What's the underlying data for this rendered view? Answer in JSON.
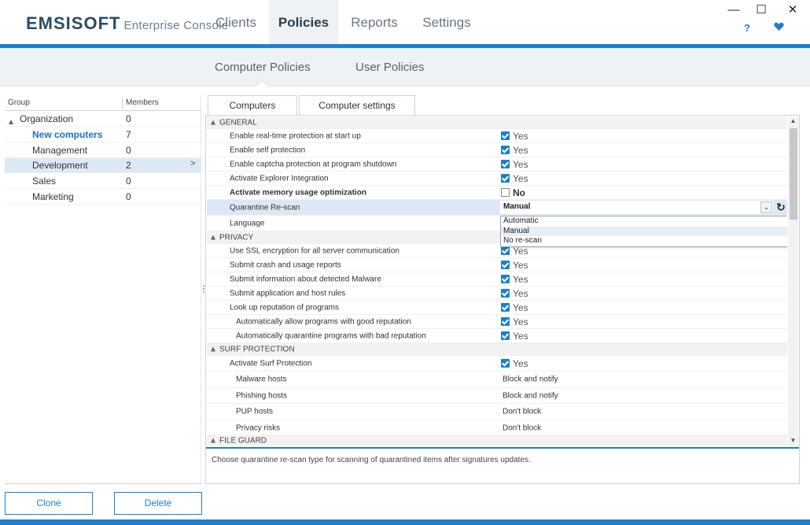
{
  "app": {
    "brand": "EMSISOFT",
    "subtitle": "Enterprise Console",
    "colors": {
      "accent": "#1c7fd0",
      "dark": "#2b4c6a",
      "selection": "#dce9f5"
    }
  },
  "nav": {
    "tabs": [
      {
        "label": "Clients"
      },
      {
        "label": "Policies"
      },
      {
        "label": "Reports"
      },
      {
        "label": "Settings"
      }
    ],
    "active": "Policies",
    "help_label": "?",
    "window": {
      "minimize": "—",
      "maximize": "☐",
      "close": "✕"
    }
  },
  "subnav": {
    "tabs": [
      {
        "label": "Computer Policies"
      },
      {
        "label": "User Policies"
      }
    ],
    "active": "Computer Policies"
  },
  "groups": {
    "headers": {
      "group": "Group",
      "members": "Members"
    },
    "rows": [
      {
        "name": "Organization",
        "members": "0"
      },
      {
        "name": "New computers",
        "members": "7"
      },
      {
        "name": "Management",
        "members": "0"
      },
      {
        "name": "Development",
        "members": "2"
      },
      {
        "name": "Sales",
        "members": "0"
      },
      {
        "name": "Marketing",
        "members": "0"
      }
    ],
    "selected": "Development",
    "buttons": {
      "clone": "Clone",
      "delete": "Delete"
    }
  },
  "right_tabs": [
    {
      "label": "Computers"
    },
    {
      "label": "Computer settings"
    }
  ],
  "settings": {
    "yes": "Yes",
    "no": "No",
    "sections": {
      "general": "GENERAL",
      "privacy": "PRIVACY",
      "surf": "SURF PROTECTION",
      "fileguard": "FILE GUARD"
    },
    "general_rows": [
      {
        "label": "Enable real-time protection at start up"
      },
      {
        "label": "Enable self protection"
      },
      {
        "label": "Enable captcha protection at program shutdown"
      },
      {
        "label": "Activate Explorer Integration"
      },
      {
        "label": "Activate memory usage optimization"
      }
    ],
    "quarantine": {
      "label": "Quarantine Re-scan",
      "value": "Manual",
      "options": [
        "Automatic",
        "Manual",
        "No re-scan"
      ]
    },
    "language_label": "Language",
    "privacy_rows": [
      {
        "label": "Use SSL encryption for all server communication"
      },
      {
        "label": "Submit crash and usage reports"
      },
      {
        "label": "Submit information about detected Malware"
      },
      {
        "label": "Submit application and host rules"
      },
      {
        "label": "Look up reputation of programs"
      },
      {
        "label": "Automatically allow programs with good reputation"
      },
      {
        "label": "Automatically quarantine programs with bad reputation"
      }
    ],
    "surf_rows": [
      {
        "label": "Activate Surf Protection",
        "value": "Yes"
      },
      {
        "label": "Malware hosts",
        "value": "Block and notify"
      },
      {
        "label": "Phishing hosts",
        "value": "Block and notify"
      },
      {
        "label": "PUP hosts",
        "value": "Don't block"
      },
      {
        "label": "Privacy risks",
        "value": "Don't block"
      }
    ],
    "description": "Choose quarantine re-scan type for scanning of quarantined items after signatures updates."
  }
}
